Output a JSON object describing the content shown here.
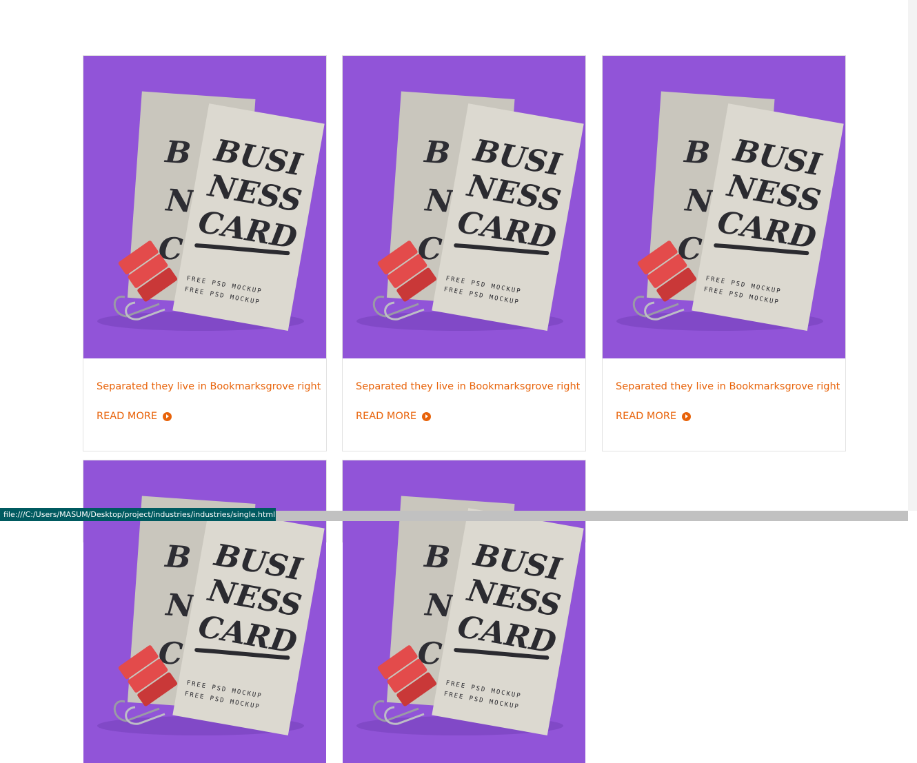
{
  "cards": [
    {
      "title": "Separated they live in Bookmarksgrove right",
      "read_more": "READ MORE",
      "image_alt": "Business card mockup"
    },
    {
      "title": "Separated they live in Bookmarksgrove right",
      "read_more": "READ MORE",
      "image_alt": "Business card mockup"
    },
    {
      "title": "Separated they live in Bookmarksgrove right",
      "read_more": "READ MORE",
      "image_alt": "Business card mockup"
    },
    {
      "image_alt": "Business card mockup"
    },
    {
      "image_alt": "Business card mockup"
    }
  ],
  "mockup": {
    "card_line_1": "BUSI",
    "card_line_2": "NESS",
    "card_line_3": "CARD",
    "card_footer_1": "FREE PSD MOCKUP",
    "card_footer_2": "FREE PSD MOCKUP"
  },
  "colors": {
    "image_bg": "#9154d8",
    "accent": "#e8630a",
    "clip": "#e34b4b"
  },
  "status_bar": {
    "url": "file:///C:/Users/MASUM/Desktop/project/industries/industries/single.html"
  },
  "icons": [
    "arrow-circle-right-icon"
  ]
}
